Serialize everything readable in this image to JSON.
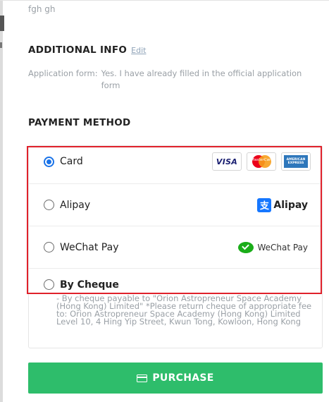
{
  "cutoff_text": "fgh gh",
  "additional_info": {
    "title": "ADDITIONAL INFO",
    "edit_label": "Edit",
    "label": "Application form:",
    "value": "Yes. I have already filled in the official application form"
  },
  "payment_method": {
    "title": "PAYMENT METHOD",
    "options": [
      {
        "label": "Card",
        "selected": true
      },
      {
        "label": "Alipay",
        "selected": false
      },
      {
        "label": "WeChat Pay",
        "selected": false
      },
      {
        "label": "By Cheque",
        "selected": false
      }
    ],
    "card_logos": {
      "visa": "VISA",
      "mastercard": "MasterCard",
      "amex_line1": "AMERICAN",
      "amex_line2": "EXPRESS"
    },
    "alipay_logo_text": "Alipay",
    "alipay_icon_char": "支",
    "wechat_logo_text": "WeChat Pay",
    "cheque_description": "- By cheque payable to \"Orion Astropreneur Space Academy (Hong Kong) Limited\" *Please return cheque of appropriate fee to: Orion Astropreneur Space Academy (Hong Kong) Limited Level 10, 4 Hing Yip Street, Kwun Tong, Kowloon, Hong Kong"
  },
  "purchase_button": {
    "label": "PURCHASE"
  },
  "colors": {
    "accent_blue": "#1a73e8",
    "purchase_green": "#2ebd6b",
    "highlight_red": "#e0212b"
  }
}
